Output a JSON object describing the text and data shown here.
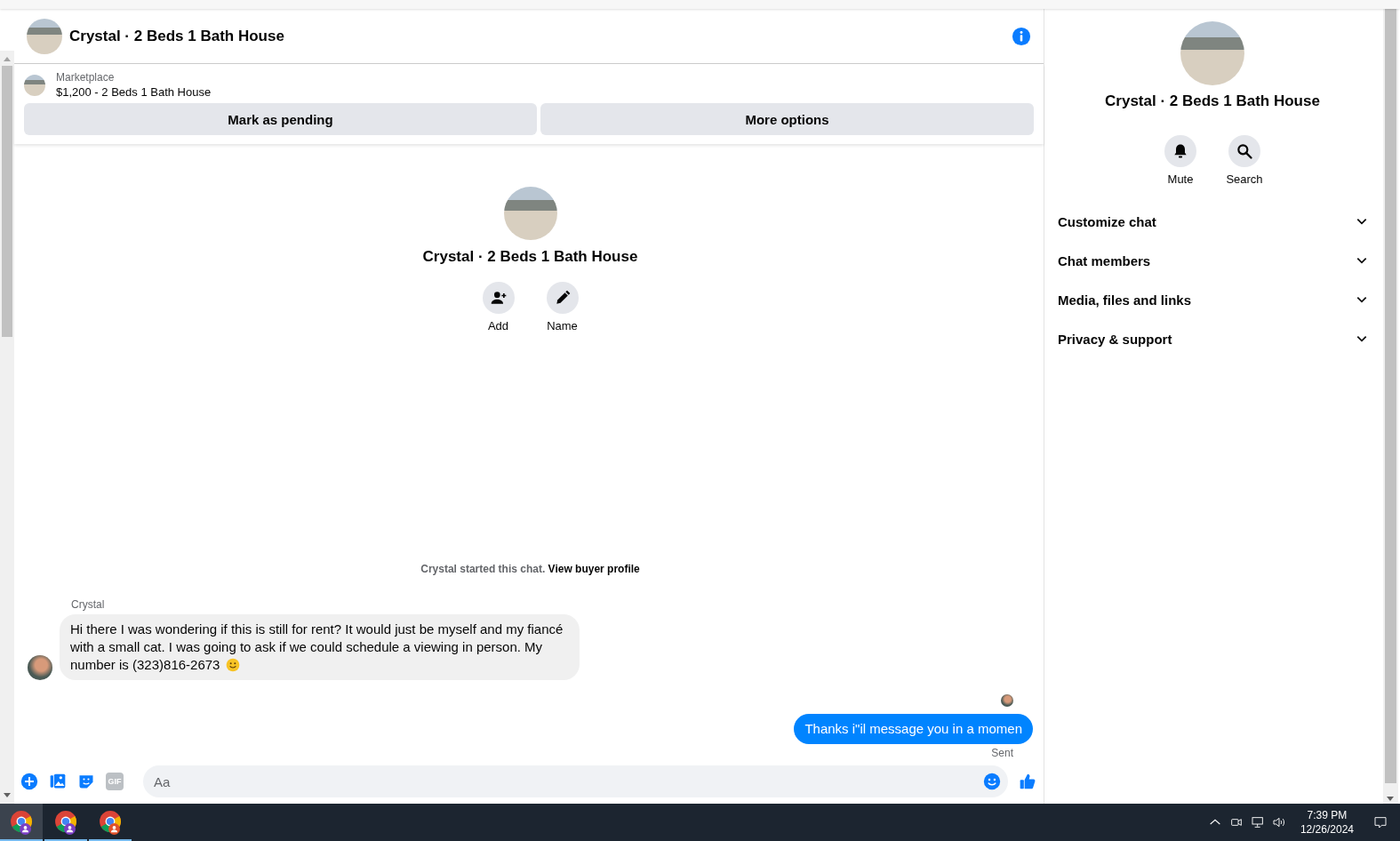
{
  "header": {
    "title": "Crystal · 2 Beds 1 Bath House"
  },
  "listing": {
    "source": "Marketplace",
    "title": "$1,200 - 2 Beds 1 Bath House",
    "actions": [
      "Mark as pending",
      "More options"
    ]
  },
  "intro": {
    "title": "Crystal · 2 Beds 1 Bath House",
    "actions": [
      {
        "label": "Add",
        "kind": "add"
      },
      {
        "label": "Name",
        "kind": "edit"
      }
    ]
  },
  "notice": {
    "text": "Crystal started this chat.",
    "link": "View buyer profile"
  },
  "messages": [
    {
      "kind": "incoming",
      "sender": "Crystal",
      "text": "Hi there I was wondering if this is still for rent? It would just be myself and my fiancé with a small cat. I was going to ask if we could schedule a viewing in person. My number is (323)816-2673"
    },
    {
      "kind": "outgoing",
      "text": "Thanks i\"il message you in a momen",
      "status": "Sent"
    }
  ],
  "composer": {
    "gif_label": "GIF",
    "placeholder": "Aa"
  },
  "details": {
    "title": "Crystal · 2 Beds 1 Bath House",
    "actions": [
      {
        "label": "Mute",
        "kind": "mute"
      },
      {
        "label": "Search",
        "kind": "search"
      }
    ],
    "sections": [
      {
        "label": "Customize chat",
        "expanded": false
      },
      {
        "label": "Chat members",
        "expanded": false
      },
      {
        "label": "Media, files and links",
        "expanded": false
      },
      {
        "label": "Privacy & support",
        "expanded": false
      }
    ]
  },
  "taskbar": {
    "apps": [
      {
        "selected": true,
        "color": "#7b3fc4"
      },
      {
        "selected": false,
        "color": "#7b3fc4"
      },
      {
        "selected": false,
        "color": "#e0502a"
      }
    ],
    "time": "7:39 PM",
    "date": "12/26/2024"
  }
}
